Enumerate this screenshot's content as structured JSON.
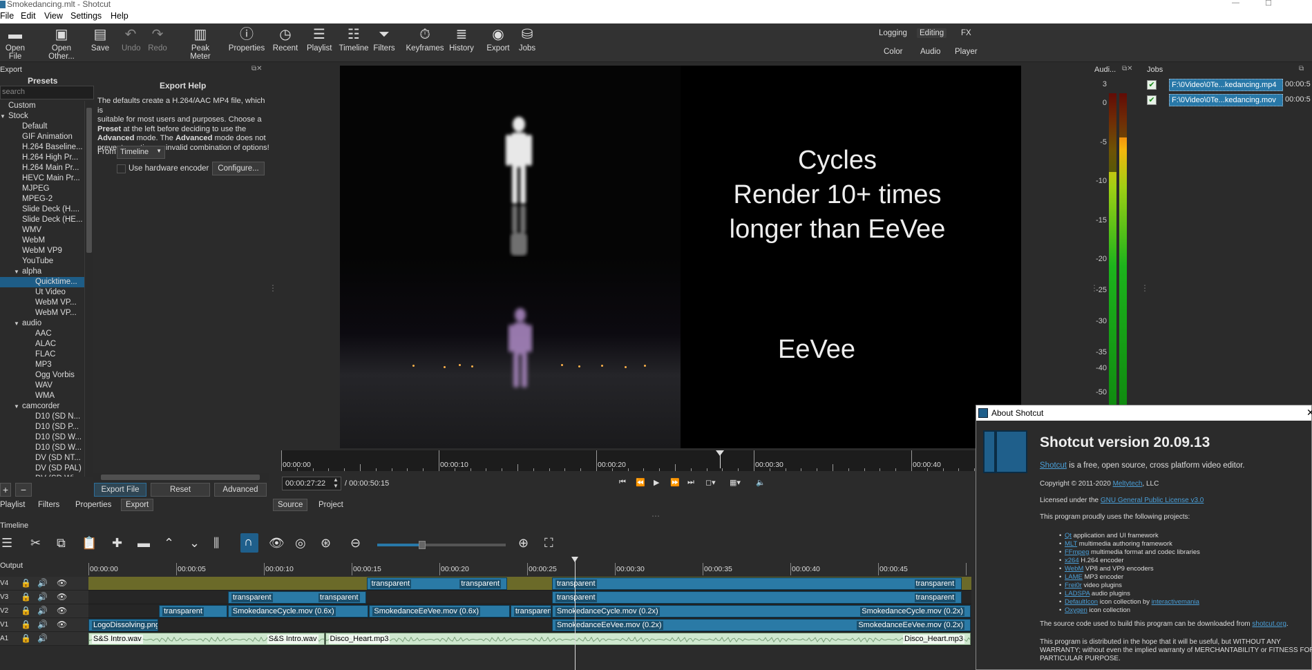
{
  "window": {
    "title": "Smokedancing.mlt - Shotcut",
    "min": "—",
    "max": "☐"
  },
  "menu": [
    "File",
    "Edit",
    "View",
    "Settings",
    "Help"
  ],
  "toolbar": [
    {
      "label": "Open File",
      "icon": "folder-open-icon",
      "glyph": "▬",
      "enabled": true
    },
    {
      "label": "Open Other...",
      "icon": "open-other-icon",
      "glyph": "▣",
      "enabled": true
    },
    {
      "label": "Save",
      "icon": "save-icon",
      "glyph": "▤",
      "enabled": true
    },
    {
      "label": "Undo",
      "icon": "undo-icon",
      "glyph": "↶",
      "enabled": false
    },
    {
      "label": "Redo",
      "icon": "redo-icon",
      "glyph": "↷",
      "enabled": false
    },
    {
      "label": "Peak Meter",
      "icon": "peak-meter-icon",
      "glyph": "▥",
      "enabled": true
    },
    {
      "label": "Properties",
      "icon": "info-icon",
      "glyph": "ⓘ",
      "enabled": true
    },
    {
      "label": "Recent",
      "icon": "clock-icon",
      "glyph": "◷",
      "enabled": true
    },
    {
      "label": "Playlist",
      "icon": "playlist-icon",
      "glyph": "☰",
      "enabled": true
    },
    {
      "label": "Timeline",
      "icon": "timeline-icon",
      "glyph": "☷",
      "enabled": true
    },
    {
      "label": "Filters",
      "icon": "funnel-icon",
      "glyph": "⏷",
      "enabled": true
    },
    {
      "label": "Keyframes",
      "icon": "stopwatch-icon",
      "glyph": "⏱",
      "enabled": true
    },
    {
      "label": "History",
      "icon": "history-icon",
      "glyph": "≣",
      "enabled": true
    },
    {
      "label": "Export",
      "icon": "export-icon",
      "glyph": "◉",
      "enabled": true
    },
    {
      "label": "Jobs",
      "icon": "jobs-icon",
      "glyph": "⛁",
      "enabled": true
    }
  ],
  "layouts": {
    "logging": "Logging",
    "editing": "Editing",
    "fx": "FX",
    "color": "Color",
    "audio": "Audio",
    "player": "Player"
  },
  "export_panel": {
    "title": "Export",
    "presets_label": "Presets",
    "search_placeholder": "search",
    "tree": [
      {
        "label": "Custom",
        "level": 0,
        "expand": ""
      },
      {
        "label": "Stock",
        "level": 0,
        "expand": "▼"
      },
      {
        "label": "Default",
        "level": 1,
        "expand": ""
      },
      {
        "label": "GIF Animation",
        "level": 1,
        "expand": ""
      },
      {
        "label": "H.264 Baseline...",
        "level": 1,
        "expand": ""
      },
      {
        "label": "H.264 High Pr...",
        "level": 1,
        "expand": ""
      },
      {
        "label": "H.264 Main Pr...",
        "level": 1,
        "expand": ""
      },
      {
        "label": "HEVC Main Pr...",
        "level": 1,
        "expand": ""
      },
      {
        "label": "MJPEG",
        "level": 1,
        "expand": ""
      },
      {
        "label": "MPEG-2",
        "level": 1,
        "expand": ""
      },
      {
        "label": "Slide Deck (H....",
        "level": 1,
        "expand": ""
      },
      {
        "label": "Slide Deck (HE...",
        "level": 1,
        "expand": ""
      },
      {
        "label": "WMV",
        "level": 1,
        "expand": ""
      },
      {
        "label": "WebM",
        "level": 1,
        "expand": ""
      },
      {
        "label": "WebM VP9",
        "level": 1,
        "expand": ""
      },
      {
        "label": "YouTube",
        "level": 1,
        "expand": ""
      },
      {
        "label": "alpha",
        "level": 1,
        "expand": "▼"
      },
      {
        "label": "Quicktime...",
        "level": 2,
        "expand": "",
        "selected": true
      },
      {
        "label": "Ut Video",
        "level": 2,
        "expand": ""
      },
      {
        "label": "WebM VP...",
        "level": 2,
        "expand": ""
      },
      {
        "label": "WebM VP...",
        "level": 2,
        "expand": ""
      },
      {
        "label": "audio",
        "level": 1,
        "expand": "▼"
      },
      {
        "label": "AAC",
        "level": 2,
        "expand": ""
      },
      {
        "label": "ALAC",
        "level": 2,
        "expand": ""
      },
      {
        "label": "FLAC",
        "level": 2,
        "expand": ""
      },
      {
        "label": "MP3",
        "level": 2,
        "expand": ""
      },
      {
        "label": "Ogg Vorbis",
        "level": 2,
        "expand": ""
      },
      {
        "label": "WAV",
        "level": 2,
        "expand": ""
      },
      {
        "label": "WMA",
        "level": 2,
        "expand": ""
      },
      {
        "label": "camcorder",
        "level": 1,
        "expand": "▼"
      },
      {
        "label": "D10 (SD N...",
        "level": 2,
        "expand": ""
      },
      {
        "label": "D10 (SD P...",
        "level": 2,
        "expand": ""
      },
      {
        "label": "D10 (SD W...",
        "level": 2,
        "expand": ""
      },
      {
        "label": "D10 (SD W...",
        "level": 2,
        "expand": ""
      },
      {
        "label": "DV (SD NT...",
        "level": 2,
        "expand": ""
      },
      {
        "label": "DV (SD PAL)",
        "level": 2,
        "expand": ""
      },
      {
        "label": "DV (SD Wi...",
        "level": 2,
        "expand": ""
      }
    ],
    "help_title": "Export Help",
    "help_line1": "The defaults create a H.264/AAC MP4 file, which is",
    "help_line2": "suitable for most users and purposes. Choose a",
    "help_preset": "Preset",
    "help_line3": " at the left before deciding to use the",
    "help_advanced1": "Advanced",
    "help_line4": " mode. The ",
    "help_advanced2": "Advanced",
    "help_line5": " mode does not",
    "help_line6": "prevent creating an invalid combination of options!",
    "from_label": "From",
    "from_value": "Timeline",
    "hw_encoder_label": "Use hardware encoder",
    "configure_label": "Configure...",
    "add_glyph": "+",
    "remove_glyph": "−",
    "export_file_label": "Export File",
    "reset_label": "Reset",
    "advanced_label": "Advanced"
  },
  "left_tabs": [
    "Playlist",
    "Filters",
    "Properties",
    "Export"
  ],
  "viewer": {
    "caption_cycles_1": "Cycles",
    "caption_cycles_2": "Render 10+ times",
    "caption_cycles_3": "longer than EeVee",
    "caption_eevee": "EeVee",
    "ruler_labels": [
      "00:00:00",
      "00:00:10",
      "00:00:20",
      "00:00:30",
      "00:00:40"
    ],
    "timecode": "00:00:27:22",
    "total": "/ 00:00:50:15",
    "source_tab": "Source",
    "project_tab": "Project"
  },
  "audio_meter": {
    "title": "Audi...",
    "scale": [
      "3",
      "0",
      "-5",
      "-10",
      "-15",
      "-20",
      "-25",
      "-30",
      "-35",
      "-40",
      "-50"
    ],
    "level_left": 0.75,
    "level_right": 0.86
  },
  "jobs": {
    "title": "Jobs",
    "items": [
      {
        "name": "F:\\0Video\\0Te...kedancing.mp4",
        "time": "00:00:5"
      },
      {
        "name": "F:\\0Video\\0Te...kedancing.mov",
        "time": "00:00:5"
      }
    ]
  },
  "timeline": {
    "title": "Timeline",
    "output_label": "Output",
    "ruler_labels": [
      "00:00:00",
      "00:00:05",
      "00:00:10",
      "00:00:15",
      "00:00:20",
      "00:00:25",
      "00:00:30",
      "00:00:35",
      "00:00:40",
      "00:00:45"
    ],
    "tracks": [
      {
        "num": "V4",
        "clips": [
          {
            "a": 0,
            "b": 31.5,
            "label": "",
            "blank": true
          },
          {
            "a": 31.5,
            "b": 47.5,
            "label": "transparent",
            "label2": "transparent"
          },
          {
            "a": 47.5,
            "b": 52.5,
            "label": "",
            "blank": true
          },
          {
            "a": 52.5,
            "b": 99,
            "label": "transparent",
            "label2": "transparent"
          },
          {
            "a": 99,
            "b": 100,
            "label": "",
            "blank": true
          }
        ]
      },
      {
        "num": "V3",
        "clips": [
          {
            "a": 15.8,
            "b": 31.5,
            "label": "transparent",
            "label2": "transparent"
          },
          {
            "a": 52.5,
            "b": 99,
            "label": "transparent",
            "label2": "transparent"
          }
        ]
      },
      {
        "num": "V2",
        "clips": [
          {
            "a": 8,
            "b": 15.8,
            "label": "transparent",
            "label2": ""
          },
          {
            "a": 15.8,
            "b": 31.8,
            "label": "SmokedanceCycle.mov (0.6x)",
            "label2": ""
          },
          {
            "a": 31.8,
            "b": 47.8,
            "label": "SmokedanceEeVee.mov (0.6x)",
            "label2": ""
          },
          {
            "a": 47.8,
            "b": 52.5,
            "label": "transparent",
            "label2": ""
          },
          {
            "a": 52.5,
            "b": 100,
            "label": "SmokedanceCycle.mov (0.2x)",
            "label2": "SmokedanceCycle.mov (0.2x)"
          }
        ]
      },
      {
        "num": "V1",
        "clips": [
          {
            "a": 0,
            "b": 8,
            "label": "LogoDissolving.png",
            "label2": ""
          },
          {
            "a": 52.5,
            "b": 100,
            "label": "SmokedanceEeVee.mov (0.2x)",
            "label2": "SmokedanceEeVee.mov (0.2x)"
          }
        ]
      },
      {
        "num": "A1",
        "clips": [
          {
            "a": 0,
            "b": 26.8,
            "label": "S&S Intro.wav",
            "label2": "S&S Intro.wav",
            "audio": true
          },
          {
            "a": 26.8,
            "b": 100,
            "label": "Disco_Heart.mp3",
            "label2": "Disco_Heart.mp3",
            "audio": true
          }
        ]
      }
    ]
  },
  "about": {
    "title": "About Shotcut",
    "close": "✕",
    "heading": "Shotcut version 20.09.13",
    "tagline_link": "Shotcut",
    "tagline_rest": " is a free, open source, cross platform video editor.",
    "copyright_pre": "Copyright © 2011-2020 ",
    "copyright_link": "Meltytech",
    "copyright_post": ", LLC",
    "license_pre": "Licensed under the ",
    "license_link": "GNU General Public License v3.0",
    "projects_intro": "This program proudly uses the following projects:",
    "projects": [
      {
        "link": "Qt",
        "text": " application and UI framework"
      },
      {
        "link": "MLT",
        "text": " multimedia authoring framework"
      },
      {
        "link": "FFmpeg",
        "text": " multimedia format and codec libraries"
      },
      {
        "link": "x264",
        "text": " H.264 encoder"
      },
      {
        "link": "WebM",
        "text": " VP8 and VP9 encoders"
      },
      {
        "link": "LAME",
        "text": " MP3 encoder"
      },
      {
        "link": "Frei0r",
        "text": " video plugins"
      },
      {
        "link": "LADSPA",
        "text": " audio plugins"
      },
      {
        "link": "DefaultIcon",
        "text": " icon collection by ",
        "link2": "interactivemania"
      },
      {
        "link": "Oxygen",
        "text": " icon collection"
      }
    ],
    "source_pre": "The source code used to build this program can be downloaded from ",
    "source_link": "shotcut.org",
    "source_post": ".",
    "warranty1": "This program is distributed in the hope that it will be useful, but WITHOUT ANY",
    "warranty2": "WARRANTY; without even the implied warranty of MERCHANTABILITY or FITNESS FOR A",
    "warranty3": "PARTICULAR PURPOSE."
  }
}
